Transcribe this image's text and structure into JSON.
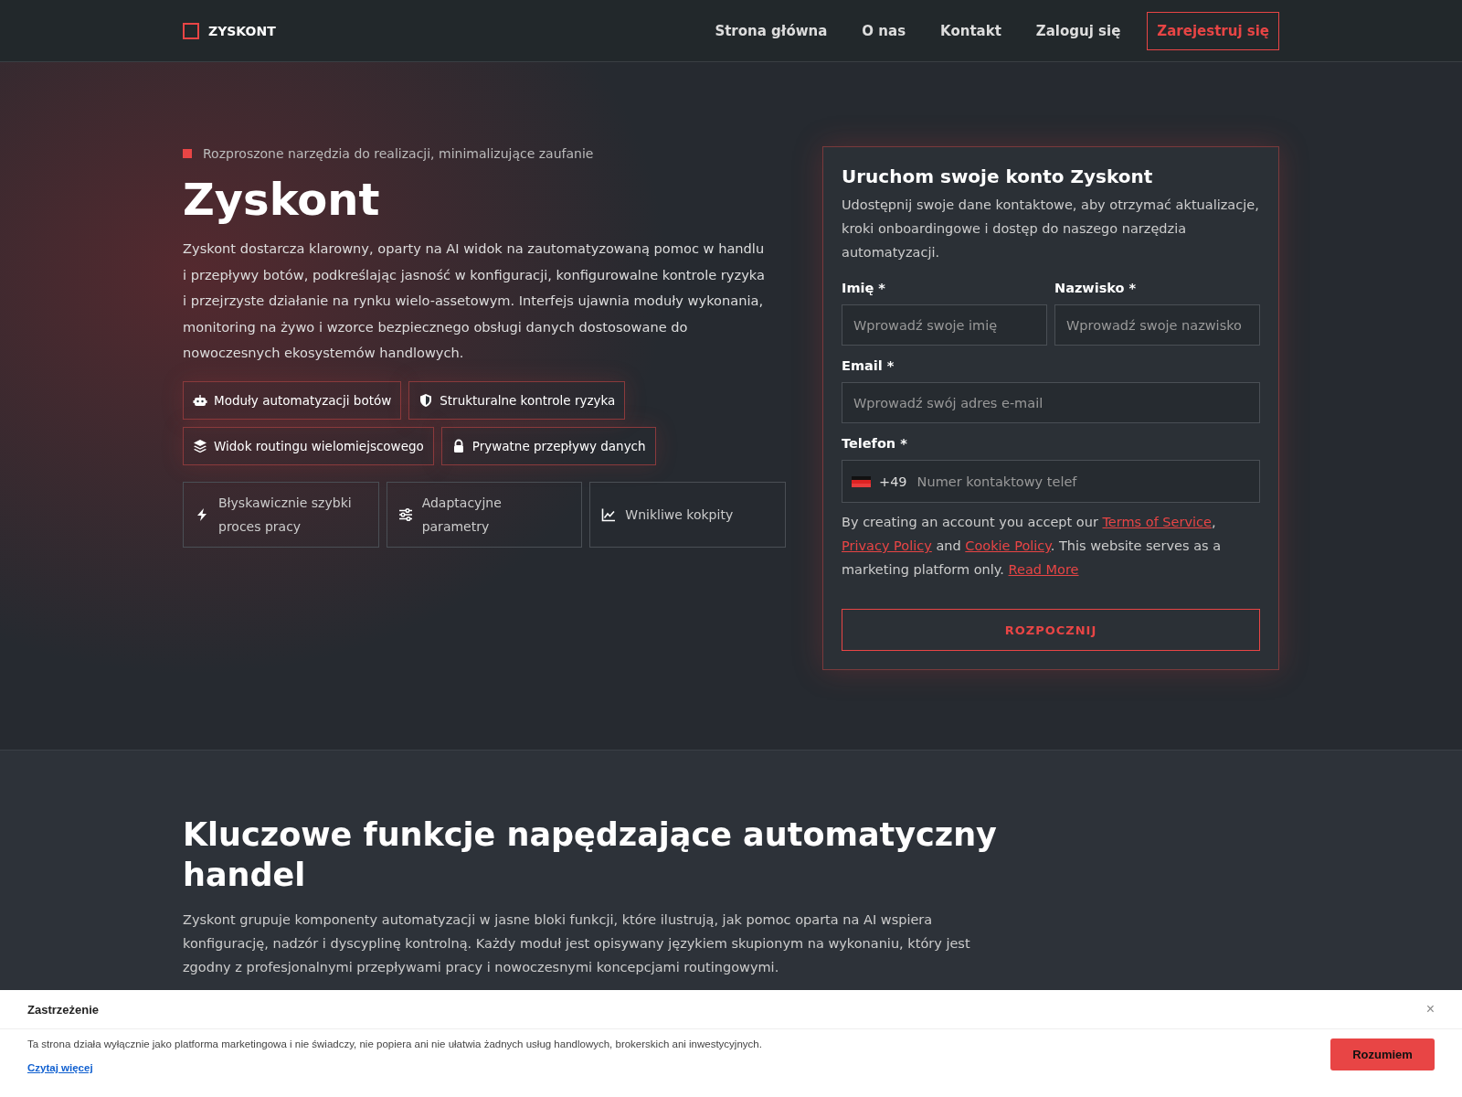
{
  "nav": {
    "logo": "ZYSKONT",
    "links": [
      {
        "label": "Strona główna",
        "kind": "link"
      },
      {
        "label": "O nas",
        "kind": "link"
      },
      {
        "label": "Kontakt",
        "kind": "link"
      },
      {
        "label": "Zaloguj się",
        "kind": "link"
      },
      {
        "label": "Zarejestruj się",
        "kind": "cta"
      }
    ]
  },
  "hero": {
    "eyebrow": "Rozproszone narzędzia do realizacji, minimalizujące zaufanie",
    "title": "Zyskont",
    "description": "Zyskont dostarcza klarowny, oparty na AI widok na zautomatyzowaną pomoc w handlu i przepływy botów, podkreślając jasność w konfiguracji, konfigurowalne kontrole ryzyka i przejrzyste działanie na rynku wielo-assetowym. Interfejs ujawnia moduły wykonania, monitoring na żywo i wzorce bezpiecznego obsługi danych dostosowane do nowoczesnych ekosystemów handlowych.",
    "tags": [
      "Moduły automatyzacji botów",
      "Strukturalne kontrole ryzyka",
      "Widok routingu wielomiejscowego",
      "Prywatne przepływy danych"
    ],
    "features": [
      "Błyskawicznie szybki proces pracy",
      "Adaptacyjne parametry",
      "Wnikliwe kokpity"
    ]
  },
  "form": {
    "title": "Uruchom swoje konto Zyskont",
    "subtitle": "Udostępnij swoje dane kontaktowe, aby otrzymać aktualizacje, kroki onboardingowe i dostęp do naszego narzędzia automatyzacji.",
    "first_name": {
      "label": "Imię *",
      "placeholder": "Wprowadź swoje imię"
    },
    "last_name": {
      "label": "Nazwisko *",
      "placeholder": "Wprowadź swoje nazwisko"
    },
    "email": {
      "label": "Email *",
      "placeholder": "Wprowadź swój adres e-mail"
    },
    "phone": {
      "label": "Telefon *",
      "code": "+49",
      "placeholder": "Numer kontaktowy telef"
    },
    "legal": [
      {
        "kind": "text",
        "text": "By creating an account you accept our "
      },
      {
        "kind": "link",
        "text": "Terms of Service"
      },
      {
        "kind": "text",
        "text": ", "
      },
      {
        "kind": "link",
        "text": "Privacy Policy"
      },
      {
        "kind": "text",
        "text": " and "
      },
      {
        "kind": "link",
        "text": "Cookie Policy"
      },
      {
        "kind": "text",
        "text": ". This website serves as a marketing platform only. "
      },
      {
        "kind": "link",
        "text": "Read More"
      }
    ],
    "submit": "ROZPOCZNIJ"
  },
  "features_section": {
    "title": "Kluczowe funkcje napędzające automatyczny handel",
    "description": "Zyskont grupuje komponenty automatyzacji w jasne bloki funkcji, które ilustrują, jak pomoc oparta na AI wspiera konfigurację, nadzór i dyscyplinę kontrolną. Każdy moduł jest opisywany językiem skupionym na wykonaniu, który jest zgodny z profesjonalnymi przepływami pracy i nowoczesnymi koncepcjami routingowymi."
  },
  "disclaimer": {
    "title": "Zastrzeżenie",
    "close": "×",
    "text": "Ta strona działa wyłącznie jako platforma marketingowa i nie świadczy, nie popiera ani nie ułatwia żadnych usług handlowych, brokerskich ani inwestycyjnych.",
    "link": "Czytaj więcej",
    "button": "Rozumiem"
  }
}
